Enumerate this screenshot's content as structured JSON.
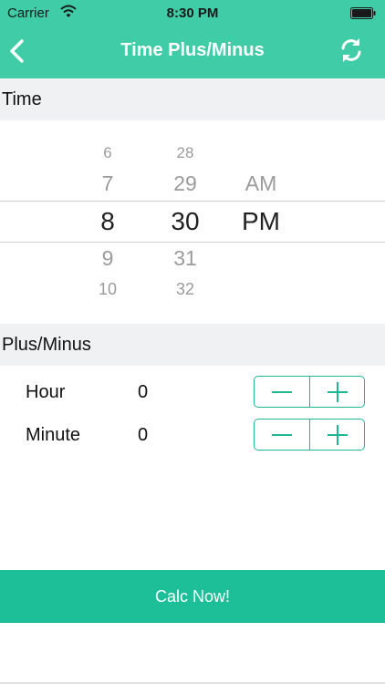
{
  "status_bar": {
    "carrier": "Carrier",
    "time": "8:30 PM"
  },
  "nav": {
    "title": "Time Plus/Minus",
    "back_icon": "chevron-left-icon",
    "refresh_icon": "refresh-icon"
  },
  "time_section": {
    "header": "Time"
  },
  "picker": {
    "hour": {
      "items": [
        "6",
        "7",
        "8",
        "9",
        "10"
      ],
      "selected": "8"
    },
    "minute": {
      "items": [
        "28",
        "29",
        "30",
        "31",
        "32"
      ],
      "selected": "30"
    },
    "period": {
      "items": [
        "AM",
        "PM"
      ],
      "selected": "PM"
    }
  },
  "plusminus_section": {
    "header": "Plus/Minus",
    "rows": [
      {
        "label": "Hour",
        "value": "0"
      },
      {
        "label": "Minute",
        "value": "0"
      }
    ]
  },
  "calc_button": {
    "label": "Calc Now!"
  },
  "colors": {
    "header": "#3fcca6",
    "accent": "#1dbf98",
    "stepper_border": "#1fb793",
    "section_bg": "#eff1f2"
  }
}
